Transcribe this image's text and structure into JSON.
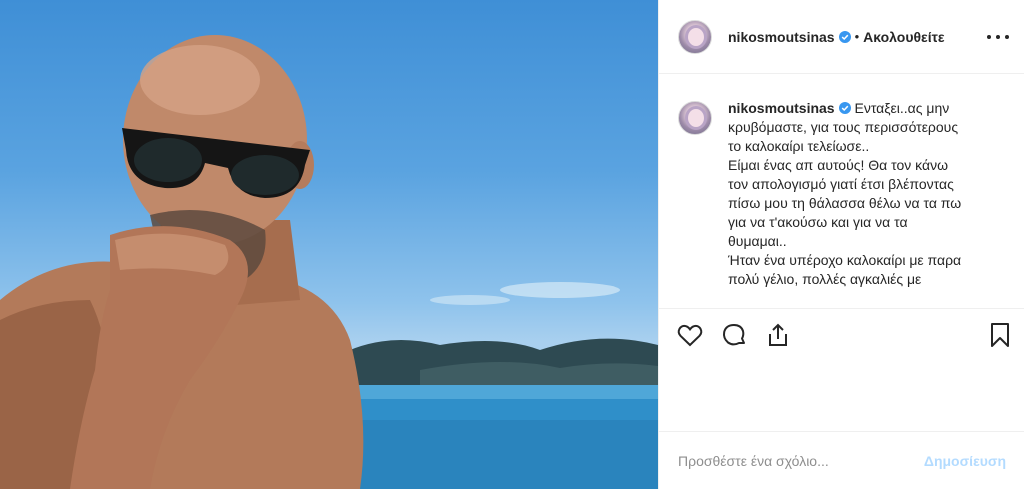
{
  "post": {
    "username": "nikosmoutsinas",
    "follow_separator": "•",
    "follow_label": "Ακολουθείτε",
    "caption": "Ενταξει..ας μην κρυβόμαστε, για τους περισσότερους το καλοκαίρι τελείωσε..\nΕίμαι ένας απ αυτούς! Θα τον κάνω τον απολογισμό γιατί έτσι βλέποντας πίσω μου τη θάλασσα θέλω να τα πω για να τ'ακούσω και για να τα θυμαμαι..\nΉταν ένα υπέροχο καλοκαίρι με παρα πολύ γέλιο, πολλές αγκαλιές με"
  },
  "comment": {
    "placeholder": "Προσθέστε ένα σχόλιο...",
    "post_label": "Δημοσίευση"
  },
  "icons": {
    "more": "more-options-icon",
    "verified": "verified-badge-icon",
    "like": "heart-icon",
    "comment": "comment-icon",
    "share": "share-icon",
    "save": "bookmark-icon"
  },
  "colors": {
    "verified": "#3897f0",
    "post_button": "#b3dbff",
    "sky": "#5aa3e0",
    "sea": "#2f8fc9"
  }
}
